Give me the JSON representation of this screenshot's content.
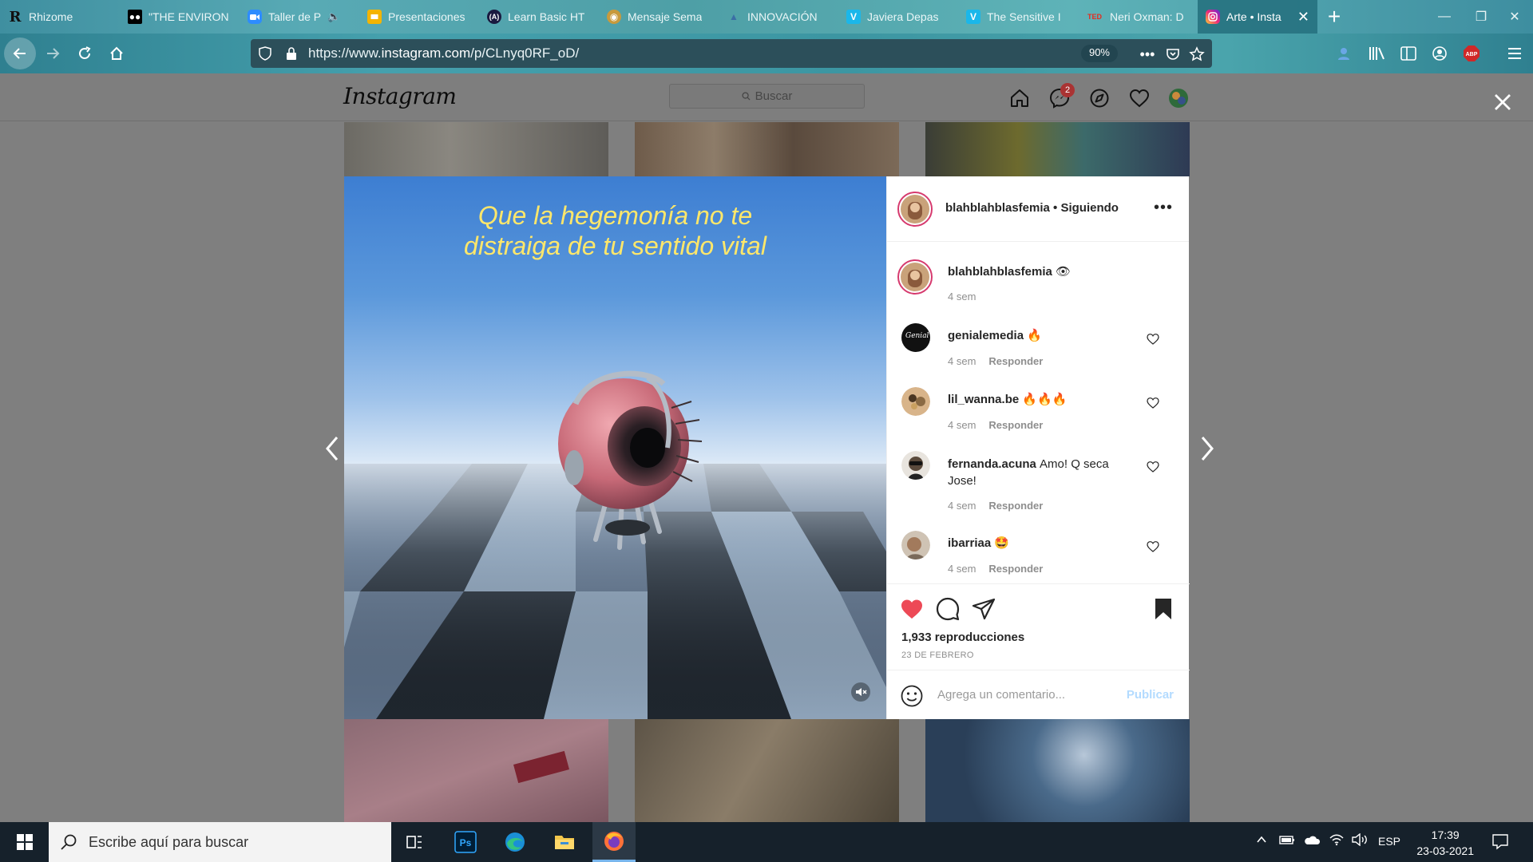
{
  "browser": {
    "tabs": [
      {
        "label": "Rhizome",
        "icon": "R",
        "icon_color": "#1b1b1b",
        "active": false
      },
      {
        "label": "\"THE ENVIRON",
        "icon": "M",
        "icon_color": "#000000",
        "active": false
      },
      {
        "label": "Taller de P",
        "icon": "zoom",
        "icon_color": "#2d8cff",
        "active": false
      },
      {
        "label": "Presentaciones",
        "icon": "slides",
        "icon_color": "#f4b400",
        "active": false
      },
      {
        "label": "Learn Basic HT",
        "icon": "(A)",
        "icon_color": "#1a1a40",
        "active": false
      },
      {
        "label": "Mensaje Sema",
        "icon": "globe",
        "icon_color": "#c89a3c",
        "active": false
      },
      {
        "label": "INNOVACIÓN",
        "icon": "",
        "icon_color": "#3b6ea5",
        "active": false
      },
      {
        "label": "Javiera Depas",
        "icon": "V",
        "icon_color": "#1ab7ea",
        "active": false
      },
      {
        "label": "The Sensitive I",
        "icon": "V",
        "icon_color": "#1ab7ea",
        "active": false
      },
      {
        "label": "Neri Oxman: D",
        "icon": "TED",
        "icon_color": "#e62b1e",
        "active": false
      },
      {
        "label": "Arte • Insta",
        "icon": "ig",
        "icon_color": "#d62976",
        "active": true
      }
    ],
    "url_prefix": "https://www.",
    "url_domain": "instagram.com",
    "url_path": "/p/CLnyq0RF_oD/",
    "zoom": "90%"
  },
  "instagram": {
    "logo": "Instagram",
    "search_placeholder": "Buscar",
    "messages_badge": "2",
    "post": {
      "quote_line1": "Que la hegemonía no te",
      "quote_line2": "distraiga de tu sentido vital",
      "author": "blahblahblasfemia",
      "follow_status": "• Siguiendo",
      "caption_user": "blahblahblasfemia",
      "caption_emoji": "👁",
      "caption_time": "4 sem",
      "comments": [
        {
          "user": "genialemedia",
          "text": "🔥",
          "time": "4 sem",
          "reply": "Responder"
        },
        {
          "user": "lil_wanna.be",
          "text": "🔥🔥🔥",
          "time": "4 sem",
          "reply": "Responder"
        },
        {
          "user": "fernanda.acuna",
          "text": "Amo! Q seca",
          "text2": "Jose!",
          "time": "4 sem",
          "reply": "Responder"
        },
        {
          "user": "ibarriaa",
          "text": "🤩",
          "time": "4 sem",
          "reply": "Responder"
        }
      ],
      "views": "1,933 reproducciones",
      "date": "23 DE FEBRERO",
      "comment_placeholder": "Agrega un comentario...",
      "publish": "Publicar"
    }
  },
  "taskbar": {
    "search_placeholder": "Escribe aquí para buscar",
    "language": "ESP",
    "time": "17:39",
    "date": "23-03-2021"
  },
  "colors": {
    "like_red": "#ed4956",
    "accent_ig": "#d63a6e",
    "publish_blue": "#b3dbff"
  }
}
